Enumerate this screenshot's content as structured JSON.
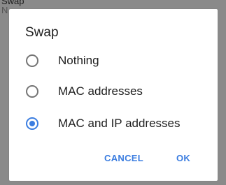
{
  "background": {
    "line1": "Swap",
    "line2": "N"
  },
  "dialog": {
    "title": "Swap",
    "options": [
      {
        "label": "Nothing",
        "selected": false
      },
      {
        "label": "MAC addresses",
        "selected": false
      },
      {
        "label": "MAC and IP addresses",
        "selected": true
      }
    ],
    "cancel_label": "CANCEL",
    "ok_label": "OK",
    "accent_color": "#3b7de0"
  }
}
